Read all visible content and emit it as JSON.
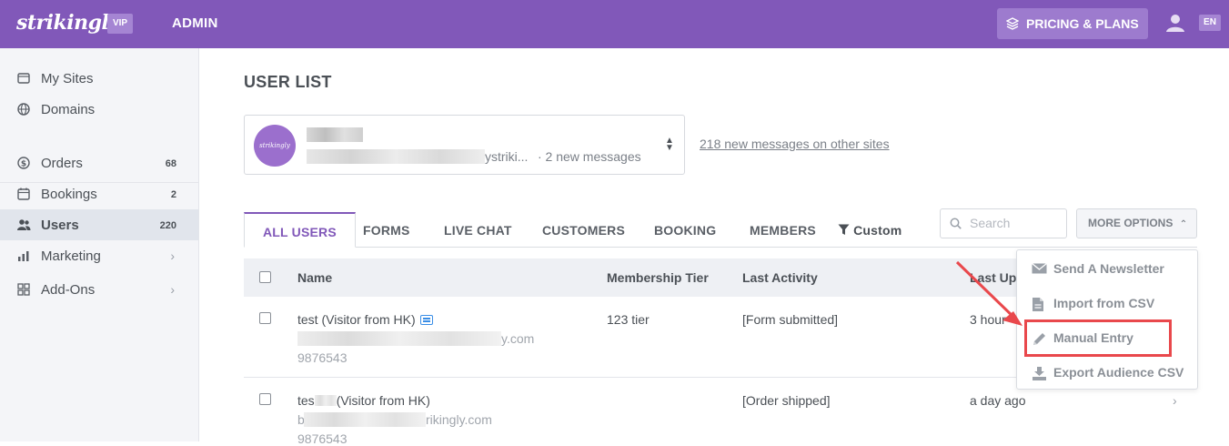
{
  "topbar": {
    "logo": "strikingly",
    "vip_badge": "VIP",
    "admin_label": "ADMIN",
    "pricing_label": "PRICING & PLANS",
    "lang": "EN",
    "accent_color": "#8158b9"
  },
  "sidebar": {
    "items": [
      {
        "label": "My Sites",
        "icon": "browser-icon"
      },
      {
        "label": "Domains",
        "icon": "globe-icon"
      },
      {
        "label": "Orders",
        "count": "68",
        "icon": "dollar-icon"
      },
      {
        "label": "Bookings",
        "count": "2",
        "icon": "calendar-icon"
      },
      {
        "label": "Users",
        "count": "220",
        "icon": "users-icon"
      },
      {
        "label": "Marketing",
        "icon": "chart-icon"
      },
      {
        "label": "Add-Ons",
        "icon": "grid-icon"
      }
    ]
  },
  "main": {
    "title": "USER LIST",
    "site_selector": {
      "logo_text": "strikingly",
      "domain_tail": "ystriki...",
      "messages": "· 2 new messages"
    },
    "other_sites_link": "218 new messages on other sites",
    "tabs": [
      {
        "label": "ALL USERS",
        "active": true
      },
      {
        "label": "FORMS"
      },
      {
        "label": "LIVE CHAT"
      },
      {
        "label": "CUSTOMERS"
      },
      {
        "label": "BOOKING"
      },
      {
        "label": "MEMBERS"
      },
      {
        "label": "Custom"
      }
    ],
    "search_placeholder": "Search",
    "more_options": "MORE OPTIONS",
    "table": {
      "headers": [
        "Name",
        "Membership Tier",
        "Last Activity",
        "Last Up"
      ],
      "rows": [
        {
          "name": "test (Visitor from HK)",
          "email_tail": "y.com",
          "phone": "9876543",
          "tier": "123 tier",
          "activity": "[Form submitted]",
          "updated": "3 hour"
        },
        {
          "name_start": "tes",
          "name_end": "(Visitor from HK)",
          "email_start": "b",
          "email_tail": "rikingly.com",
          "phone": "9876543",
          "tier": "",
          "activity": "[Order shipped]",
          "updated": "a day ago"
        }
      ]
    },
    "dropdown": {
      "items": [
        {
          "label": "Send A Newsletter",
          "icon": "envelope-icon"
        },
        {
          "label": "Import from CSV",
          "icon": "file-icon"
        },
        {
          "label": "Manual Entry",
          "icon": "pencil-icon"
        },
        {
          "label": "Export Audience CSV",
          "icon": "download-icon"
        }
      ]
    }
  }
}
